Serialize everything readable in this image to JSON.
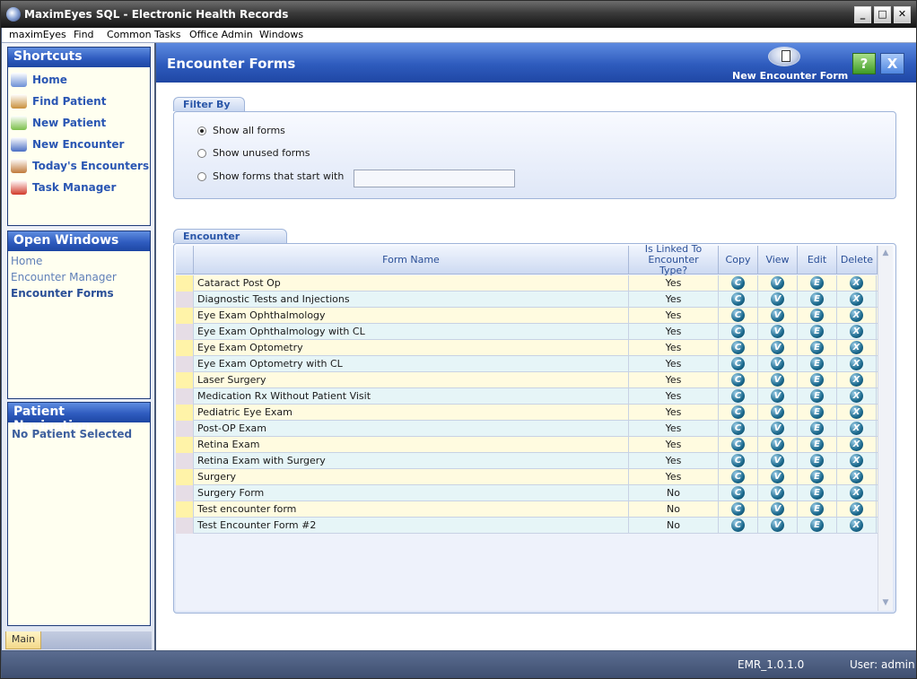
{
  "window": {
    "title": "MaximEyes SQL - Electronic Health Records",
    "min": "_",
    "max": "□",
    "close": "✕"
  },
  "menu": [
    "maximEyes",
    "Find",
    "Common Tasks",
    "Office Admin",
    "Windows"
  ],
  "shortcuts": {
    "title": "Shortcuts",
    "items": [
      {
        "label": "Home",
        "icon": "home-icon",
        "color": "#6c8fd6"
      },
      {
        "label": "Find Patient",
        "icon": "find-patient-icon",
        "color": "#c98f3c"
      },
      {
        "label": "New Patient",
        "icon": "new-patient-icon",
        "color": "#7bbf4a"
      },
      {
        "label": "New Encounter",
        "icon": "new-encounter-icon",
        "color": "#4a6fc4"
      },
      {
        "label": "Today's Encounters",
        "icon": "todays-encounters-icon",
        "color": "#c07a3a"
      },
      {
        "label": "Task Manager",
        "icon": "task-manager-icon",
        "color": "#d23a2a"
      }
    ]
  },
  "open_windows": {
    "title": "Open Windows",
    "items": [
      {
        "label": "Home",
        "active": false
      },
      {
        "label": "Encounter Manager",
        "active": false
      },
      {
        "label": "Encounter Forms",
        "active": true
      }
    ]
  },
  "patient_nav": {
    "title": "Patient Navigation",
    "status": "No Patient Selected"
  },
  "left_tabs": {
    "main": "Main"
  },
  "header": {
    "title": "Encounter Forms",
    "new_form": "New Encounter Form",
    "help": "?",
    "close": "X"
  },
  "filter": {
    "title": "Filter By",
    "options": [
      {
        "label": "Show all forms",
        "selected": true
      },
      {
        "label": "Show unused forms",
        "selected": false
      },
      {
        "label": "Show forms that start with",
        "selected": false
      }
    ],
    "starts_with_value": ""
  },
  "forms": {
    "title": "Encounter Forms",
    "columns": {
      "name": "Form Name",
      "linked": "Is Linked To Encounter Type?",
      "copy": "Copy",
      "view": "View",
      "edit": "Edit",
      "delete": "Delete"
    },
    "action_glyphs": {
      "copy": "C",
      "view": "V",
      "edit": "E",
      "delete": "X"
    },
    "rows": [
      {
        "name": "Cataract Post Op",
        "linked": "Yes"
      },
      {
        "name": "Diagnostic Tests and Injections",
        "linked": "Yes"
      },
      {
        "name": "Eye Exam Ophthalmology",
        "linked": "Yes"
      },
      {
        "name": "Eye Exam Ophthalmology with CL",
        "linked": "Yes"
      },
      {
        "name": "Eye Exam Optometry",
        "linked": "Yes"
      },
      {
        "name": "Eye Exam Optometry with CL",
        "linked": "Yes"
      },
      {
        "name": "Laser Surgery",
        "linked": "Yes"
      },
      {
        "name": "Medication Rx Without Patient Visit",
        "linked": "Yes"
      },
      {
        "name": "Pediatric Eye Exam",
        "linked": "Yes"
      },
      {
        "name": "Post-OP Exam",
        "linked": "Yes"
      },
      {
        "name": "Retina Exam",
        "linked": "Yes"
      },
      {
        "name": "Retina Exam with Surgery",
        "linked": "Yes"
      },
      {
        "name": "Surgery",
        "linked": "Yes"
      },
      {
        "name": "Surgery Form",
        "linked": "No"
      },
      {
        "name": "Test encounter form",
        "linked": "No"
      },
      {
        "name": "Test Encounter Form #2",
        "linked": "No"
      }
    ]
  },
  "status": {
    "version": "EMR_1.0.1.0",
    "user": "User: admin"
  }
}
